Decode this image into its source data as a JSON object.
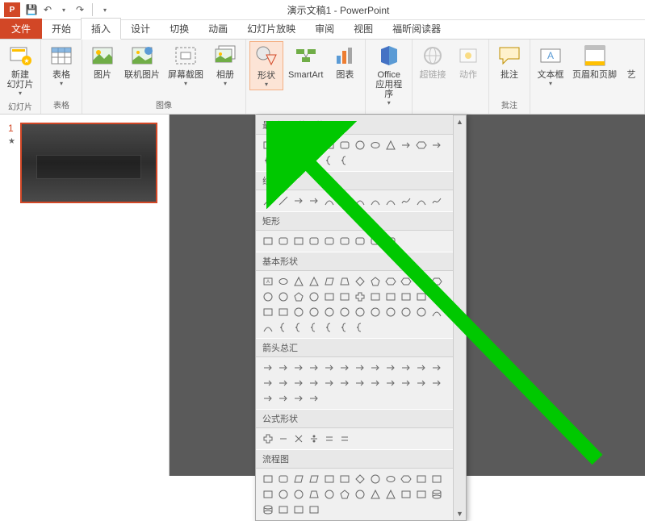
{
  "app": {
    "icon_letter": "P",
    "title": "演示文稿1 - PowerPoint"
  },
  "qat": {
    "save": "💾",
    "undo": "↶",
    "redo": "↷"
  },
  "tabs": {
    "file": "文件",
    "items": [
      "开始",
      "插入",
      "设计",
      "切换",
      "动画",
      "幻灯片放映",
      "审阅",
      "视图",
      "福昕阅读器"
    ],
    "active_index": 1
  },
  "ribbon": {
    "groups": {
      "slides": {
        "label": "幻灯片",
        "new_slide": "新建\n幻灯片"
      },
      "tables": {
        "label": "表格",
        "table": "表格"
      },
      "images": {
        "label": "图像",
        "picture": "图片",
        "online_picture": "联机图片",
        "screenshot": "屏幕截图",
        "album": "相册"
      },
      "illustrations": {
        "label": "",
        "shapes": "形状",
        "smartart": "SmartArt",
        "chart": "图表"
      },
      "apps": {
        "label": "",
        "office_apps": "Office\n应用程序"
      },
      "links": {
        "label": "",
        "hyperlink": "超链接",
        "action": "动作"
      },
      "comments": {
        "label": "批注",
        "comment": "批注"
      },
      "text": {
        "label": "",
        "textbox": "文本框",
        "header_footer": "页眉和页脚",
        "wordart": "艺"
      }
    }
  },
  "thumbs": {
    "slide1_num": "1",
    "star": "★"
  },
  "shapes_dropdown": {
    "categories": {
      "recent": "最近使用的形状",
      "lines": "线条",
      "rectangles": "矩形",
      "basic": "基本形状",
      "arrows": "箭头总汇",
      "equation": "公式形状",
      "flowchart": "流程图"
    }
  }
}
